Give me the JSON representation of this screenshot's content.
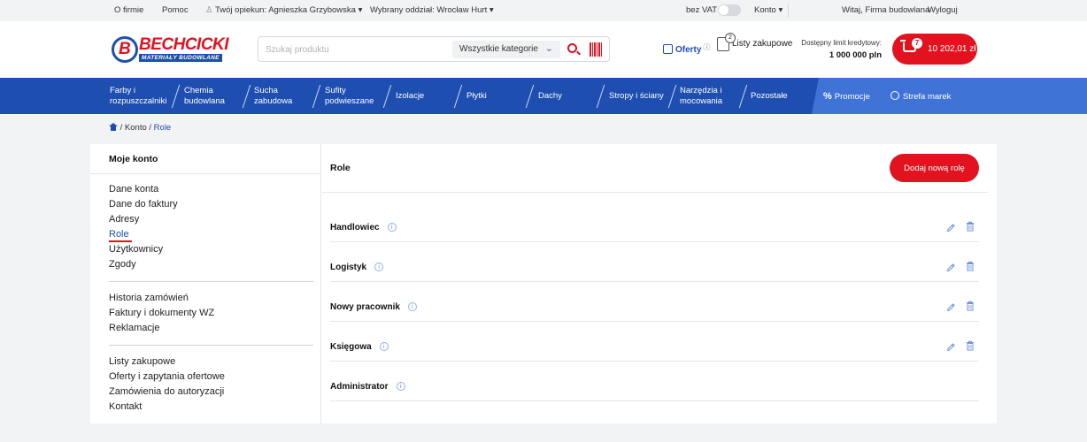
{
  "topbar": {
    "about": "O firmie",
    "help": "Pomoc",
    "advisor": "Twój opiekun: Agnieszka Grzybowska",
    "branch": "Wybrany oddział: Wrocław Hurt",
    "vat_label": "bez VAT",
    "account": "Konto",
    "welcome": "Witaj, Firma budowlana",
    "logout": "Wyloguj"
  },
  "brand": {
    "name": "BECHCICKI",
    "tagline": "MATERIAŁY BUDOWLANE"
  },
  "search": {
    "placeholder": "Szukaj produktu",
    "category": "Wszystkie kategorie"
  },
  "header": {
    "offers": "Oferty",
    "lists": "Listy zakupowe",
    "lists_count": "2",
    "credit_label": "Dostępny limit kredytowy:",
    "credit_value": "1 000 000 pln",
    "cart_count": "7",
    "cart_amount": "10 202,01 zł"
  },
  "nav": {
    "items": [
      {
        "line1": "Farby i",
        "line2": "rozpuszczalniki"
      },
      {
        "line1": "Chemia",
        "line2": "budowlana"
      },
      {
        "line1": "Sucha",
        "line2": "zabudowa"
      },
      {
        "line1": "Sufity",
        "line2": "podwieszane"
      },
      {
        "line1": "Izolacje",
        "line2": ""
      },
      {
        "line1": "Płytki",
        "line2": ""
      },
      {
        "line1": "Dachy",
        "line2": ""
      },
      {
        "line1": "Stropy i ściany",
        "line2": ""
      },
      {
        "line1": "Narzędzia i",
        "line2": "mocowania"
      },
      {
        "line1": "Pozostałe",
        "line2": ""
      }
    ],
    "promo": "Promocje",
    "brands": "Strefa marek"
  },
  "breadcrumb": {
    "sep": "/",
    "account": "Konto",
    "current": "Role"
  },
  "sidebar": {
    "title": "Moje konto",
    "group1": [
      "Dane konta",
      "Dane do faktury",
      "Adresy",
      "Role",
      "Użytkownicy",
      "Zgody"
    ],
    "group2": [
      "Historia zamówień",
      "Faktury i dokumenty WZ",
      "Reklamacje"
    ],
    "group3": [
      "Listy zakupowe",
      "Oferty i zapytania ofertowe",
      "Zamówienia do autoryzacji",
      "Kontakt"
    ]
  },
  "main": {
    "title": "Role",
    "add_button": "Dodaj nową rolę",
    "roles": [
      {
        "name": "Handlowiec",
        "editable": true
      },
      {
        "name": "Logistyk",
        "editable": true
      },
      {
        "name": "Nowy pracownik",
        "editable": true
      },
      {
        "name": "Księgowa",
        "editable": true
      },
      {
        "name": "Administrator",
        "editable": false
      }
    ]
  },
  "colors": {
    "brand_red": "#e2121f",
    "brand_blue": "#1e4fb0"
  }
}
